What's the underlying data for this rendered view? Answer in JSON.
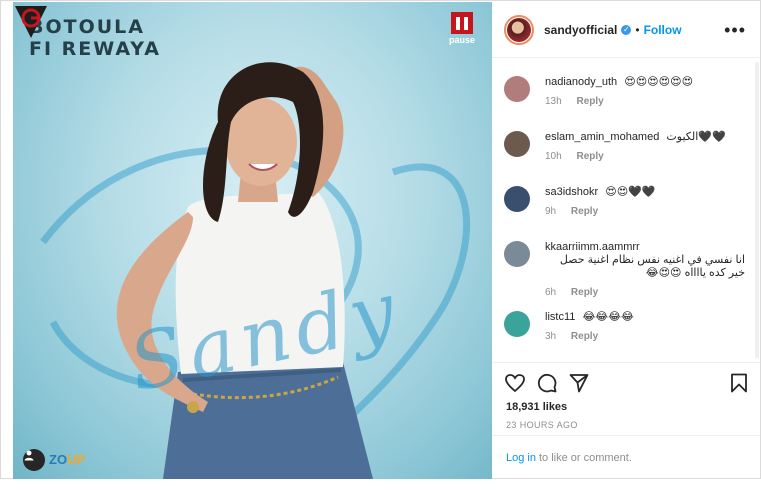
{
  "cover": {
    "title_line1": "BOTOULA",
    "title_line2": "FI REWAYA",
    "pause_label": "pause",
    "signature": "Sandy",
    "up_label_a": "ZO",
    "up_label_b": "UP"
  },
  "post": {
    "username": "sandyofficial",
    "verified": true,
    "follow_label": "Follow",
    "more_label": "•••",
    "likes": "18,931 likes",
    "timestamp": "23 HOURS AGO",
    "login_link": "Log in",
    "login_text": "to like or comment."
  },
  "comments": [
    {
      "user": "nadianody_uth",
      "text": "😍😍😍😍😍😍",
      "time": "13h",
      "reply": "Reply",
      "avatar_color": "#b07c7c"
    },
    {
      "user": "eslam_amin_mohamed",
      "text": "الكيوت🖤🖤",
      "time": "10h",
      "reply": "Reply",
      "avatar_color": "#6b5a4d"
    },
    {
      "user": "sa3idshokr",
      "text": "😍😍🖤🖤",
      "time": "9h",
      "reply": "Reply",
      "avatar_color": "#3a4f6e"
    },
    {
      "user": "kkaarriimm.aammrr",
      "text": "انا نفسي في اغنيه نفس نظام اغنية حصل خير كده يااااه 😍😍😂",
      "time": "6h",
      "reply": "Reply",
      "avatar_color": "#7a8a96"
    },
    {
      "user": "listc11",
      "text": "😂😂😂😂",
      "time": "3h",
      "reply": "Reply",
      "avatar_color": "#3aa39a"
    }
  ],
  "colors": {
    "accent": "#0095f6",
    "verified": "#3897f0",
    "muted": "#8e8e8e"
  },
  "icons": [
    "heart-icon",
    "comment-icon",
    "share-icon",
    "bookmark-icon",
    "more-icon",
    "user-tag-icon"
  ]
}
